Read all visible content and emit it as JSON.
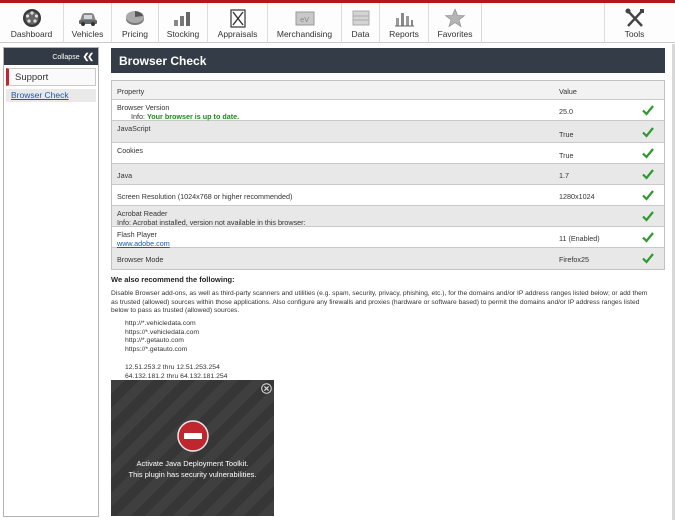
{
  "nav": {
    "items": [
      {
        "label": "Dashboard",
        "icon": "dashboard-icon"
      },
      {
        "label": "Vehicles",
        "icon": "car-icon"
      },
      {
        "label": "Pricing",
        "icon": "pricing-icon"
      },
      {
        "label": "Stocking",
        "icon": "stocking-icon"
      },
      {
        "label": "Appraisals",
        "icon": "appraisals-icon"
      },
      {
        "label": "Merchandising",
        "icon": "merchandising-icon"
      },
      {
        "label": "Data",
        "icon": "data-icon"
      },
      {
        "label": "Reports",
        "icon": "reports-icon"
      },
      {
        "label": "Favorites",
        "icon": "star-icon"
      },
      {
        "label": "Tools",
        "icon": "tools-icon"
      }
    ]
  },
  "sidebar": {
    "collapse_label": "Collapse",
    "collapse_icon": "double-chevron-left-icon",
    "section_label": "Support",
    "link_label": "Browser Check"
  },
  "main": {
    "title": "Browser Check"
  },
  "table": {
    "header": {
      "property": "Property",
      "value": "Value"
    },
    "rows": [
      {
        "property": "Browser Version",
        "info": "Info: ",
        "info_status": "Your browser is up to date.",
        "value": "25.0",
        "status": "ok"
      },
      {
        "property": "JavaScript",
        "value": "True",
        "status": "ok"
      },
      {
        "property": "Cookies",
        "value": "True",
        "status": "ok"
      },
      {
        "property": "Java",
        "value": "1.7",
        "status": "ok"
      },
      {
        "property": "Screen Resolution (1024x768 or higher recommended)",
        "value": "1280x1024",
        "status": "ok"
      },
      {
        "property": "Acrobat Reader",
        "info": "Info: Acrobat installed, version not available in this browser:",
        "value": "",
        "status": "ok"
      },
      {
        "property": "Flash Player",
        "link": "www.adobe.com",
        "value": "11 (Enabled)",
        "status": "ok"
      },
      {
        "property": "Browser Mode",
        "value": "Firefox25",
        "status": "ok"
      }
    ],
    "check_color": "#2e9a2e"
  },
  "recommend": {
    "title": "We also recommend the following:",
    "text": "Disable Browser add-ons, as well as third-party scanners and utilities (e.g. spam, security, privacy, phishing, etc.), for the domains and/or IP address ranges listed below; or add them as trusted (allowed) sources within those applications. Also configure any firewalls and proxies (hardware or software based) to permit the domains and/or IP address ranges listed below to pass as trusted (allowed) sources.",
    "urls": [
      "http://*.vehicledata.com",
      "https://*.vehicledata.com",
      "http://*.getauto.com",
      "https://*.getauto.com"
    ],
    "ranges": [
      "12.51.253.2 thru 12.51.253.254",
      "64.132.181.2 thru 64.132.181.254"
    ]
  },
  "java_overlay": {
    "line1": "Activate Java Deployment Toolkit.",
    "line2": "This plugin has security vulnerabilities.",
    "stop_icon": "blocked-plugin-icon",
    "close_icon": "close-icon",
    "stop_color": "#c0262d"
  },
  "colors": {
    "brand_red": "#b8141b",
    "header_dark": "#343d47"
  }
}
